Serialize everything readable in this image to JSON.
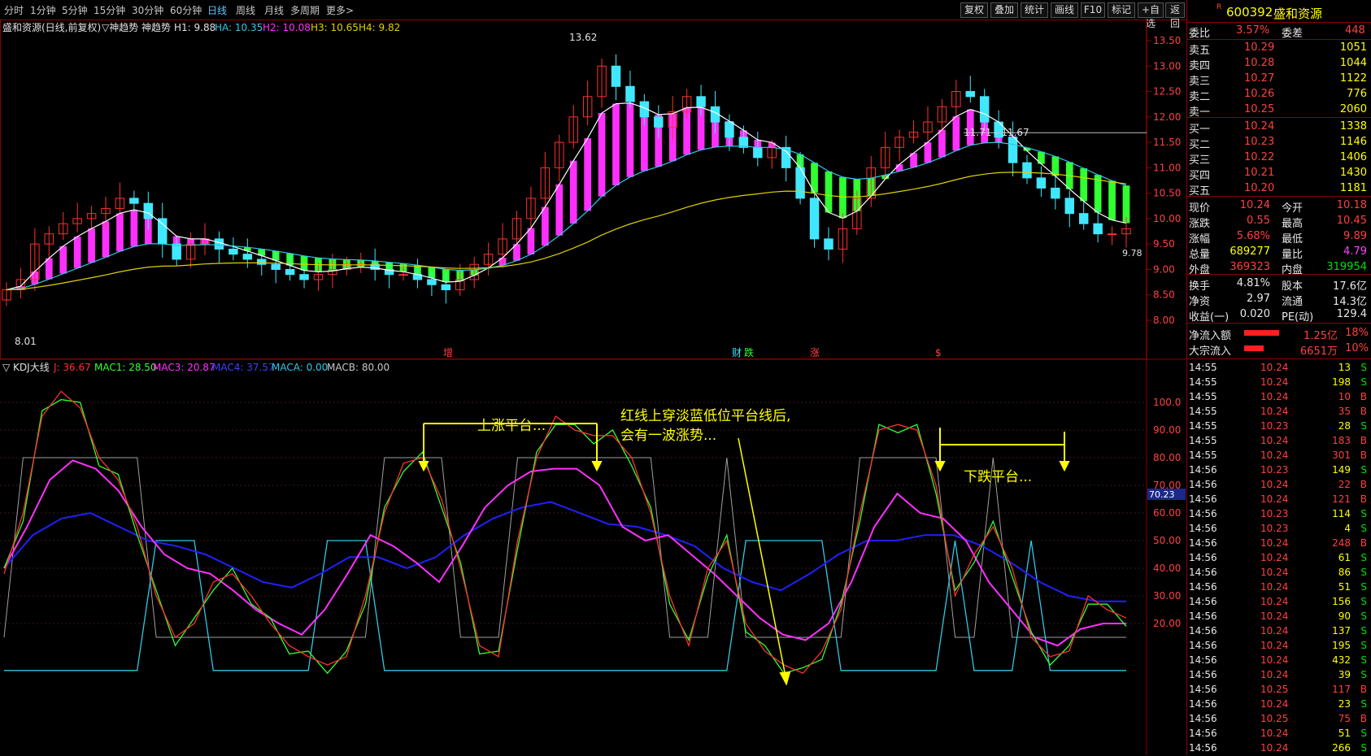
{
  "toolbar": {
    "periods": [
      "分时",
      "1分钟",
      "5分钟",
      "15分钟",
      "30分钟",
      "60分钟",
      "日线",
      "周线",
      "月线",
      "多周期",
      "更多>"
    ],
    "active_period": "日线",
    "buttons": [
      "复权",
      "叠加",
      "统计",
      "画线",
      "F10",
      "标记",
      "+自选",
      "返回"
    ]
  },
  "top_header": {
    "name": "盛和资源(日线,前复权)",
    "indicator": "▽神趋势 神趋势",
    "h1": "H1: 9.88",
    "ha": "HA: 10.35",
    "h2": "H2: 10.08",
    "h3": "H3: 10.65",
    "h4": "H4: 9.82"
  },
  "bottom_header": {
    "indicator": "▽ KDJ大线",
    "j": "J: 36.67",
    "mac1": "MAC1: 28.50",
    "mac3": "MAC3: 20.87",
    "mac4": "MAC4: 37.57",
    "maca": "MACA: 0.00",
    "macb": "MACB: 80.00"
  },
  "colors": {
    "up": "#ff3030",
    "down": "#40e8ff",
    "magenta": "#ff30ff",
    "green": "#30ff30",
    "yellow": "#e0d000",
    "frame": "#8b0000",
    "blue": "#2020ff",
    "cyan": "#30c8e8"
  },
  "annotations": {
    "up_platform": "上涨平台...",
    "cross_line1": "红线上穿淡蓝低位平台线后,",
    "cross_line2": "会有一波涨势...",
    "down_platform": "下跌平台..."
  },
  "chart_data": [
    {
      "type": "candlestick",
      "title": "盛和资源(日线,前复权)",
      "ylim": [
        7.8,
        13.8
      ],
      "y_ticks": [
        "13.50",
        "13.00",
        "12.50",
        "12.00",
        "11.50",
        "11.00",
        "10.50",
        "10.00",
        "9.50",
        "9.00",
        "8.50",
        "8.00"
      ],
      "price_labels": {
        "high": "13.62",
        "low": "8.01",
        "last": "9.78",
        "line": "11.71 - 11.67"
      },
      "events": [
        "增",
        "财",
        "跌",
        "涨",
        "$"
      ],
      "closes_approx": [
        8.6,
        8.8,
        9.5,
        9.7,
        9.9,
        10.0,
        10.1,
        10.2,
        10.4,
        10.3,
        10.0,
        9.5,
        9.2,
        9.5,
        9.6,
        9.4,
        9.3,
        9.2,
        9.1,
        9.0,
        8.9,
        8.8,
        8.9,
        9.0,
        9.1,
        9.1,
        9.0,
        8.9,
        8.9,
        8.8,
        8.7,
        8.6,
        8.8,
        9.1,
        9.3,
        9.6,
        10.0,
        10.4,
        11.0,
        11.5,
        12.0,
        12.4,
        13.0,
        12.6,
        12.3,
        12.0,
        11.8,
        12.1,
        12.4,
        12.2,
        11.9,
        11.6,
        11.4,
        11.2,
        11.4,
        11.0,
        10.4,
        9.6,
        9.4,
        9.8,
        10.4,
        11.0,
        11.4,
        11.6,
        11.7,
        11.9,
        12.2,
        12.5,
        12.4,
        11.9,
        11.6,
        11.1,
        10.8,
        10.6,
        10.4,
        10.1,
        9.9,
        9.7,
        9.7,
        9.8
      ],
      "lines": [
        {
          "name": "H1",
          "value": 9.88
        },
        {
          "name": "HA",
          "value": 10.35
        },
        {
          "name": "H2",
          "value": 10.08
        },
        {
          "name": "H3",
          "value": 10.65
        },
        {
          "name": "H4",
          "value": 9.82
        }
      ]
    },
    {
      "type": "line",
      "title": "KDJ大线",
      "ylim": [
        0,
        110
      ],
      "y_ticks": [
        "100.0",
        "90.00",
        "80.00",
        "70.00",
        "60.00",
        "50.00",
        "40.00",
        "30.00",
        "20.00"
      ],
      "cursor_label": "70.23",
      "series": [
        {
          "name": "J",
          "value": 36.67,
          "color": "#ff3030"
        },
        {
          "name": "MAC1",
          "value": 28.5,
          "color": "#30ff30"
        },
        {
          "name": "MAC3",
          "value": 20.87,
          "color": "#ff30ff"
        },
        {
          "name": "MAC4",
          "value": 37.57,
          "color": "#2020ff"
        },
        {
          "name": "MACA",
          "value": 0.0,
          "color": "#30c8e8"
        },
        {
          "name": "MACB",
          "value": 80.0,
          "color": "#c8c8c8"
        }
      ],
      "k_approx": [
        38,
        60,
        95,
        104,
        98,
        80,
        72,
        55,
        30,
        15,
        20,
        35,
        38,
        30,
        20,
        12,
        8,
        5,
        8,
        30,
        60,
        78,
        80,
        65,
        40,
        12,
        8,
        50,
        80,
        95,
        90,
        88,
        88,
        80,
        60,
        30,
        12,
        40,
        50,
        20,
        10,
        5,
        2,
        10,
        25,
        60,
        90,
        92,
        90,
        70,
        30,
        45,
        55,
        40,
        15,
        8,
        10,
        30,
        25,
        22
      ],
      "mac3_approx": [
        40,
        55,
        72,
        79,
        76,
        68,
        55,
        45,
        40,
        38,
        32,
        25,
        20,
        16,
        25,
        38,
        52,
        48,
        42,
        35,
        48,
        62,
        70,
        75,
        76,
        76,
        70,
        55,
        50,
        52,
        45,
        38,
        30,
        22,
        16,
        14,
        20,
        35,
        55,
        67,
        60,
        58,
        50,
        35,
        25,
        15,
        12,
        18,
        20,
        20
      ],
      "mac4_approx": [
        40,
        52,
        58,
        60,
        55,
        50,
        48,
        45,
        40,
        35,
        33,
        38,
        44,
        44,
        40,
        44,
        52,
        58,
        62,
        64,
        60,
        56,
        55,
        52,
        48,
        40,
        35,
        32,
        38,
        45,
        50,
        50,
        52,
        52,
        48,
        42,
        35,
        30,
        28,
        28
      ]
    }
  ],
  "quote": {
    "code": "600392",
    "name": "盛和资源",
    "tag": "R",
    "weibi_label": "委比",
    "weibi": "3.57%",
    "weicha_label": "委差",
    "weicha": "448",
    "asks": [
      {
        "label": "卖五",
        "price": "10.29",
        "vol": "1051"
      },
      {
        "label": "卖四",
        "price": "10.28",
        "vol": "1044"
      },
      {
        "label": "卖三",
        "price": "10.27",
        "vol": "1122"
      },
      {
        "label": "卖二",
        "price": "10.26",
        "vol": "776"
      },
      {
        "label": "卖一",
        "price": "10.25",
        "vol": "2060"
      }
    ],
    "bids": [
      {
        "label": "买一",
        "price": "10.24",
        "vol": "1338"
      },
      {
        "label": "买二",
        "price": "10.23",
        "vol": "1146"
      },
      {
        "label": "买三",
        "price": "10.22",
        "vol": "1406"
      },
      {
        "label": "买四",
        "price": "10.21",
        "vol": "1430"
      },
      {
        "label": "买五",
        "price": "10.20",
        "vol": "1181"
      }
    ],
    "stats": [
      {
        "l1": "现价",
        "v1": "10.24",
        "l2": "今开",
        "v2": "10.18"
      },
      {
        "l1": "涨跌",
        "v1": "0.55",
        "l2": "最高",
        "v2": "10.45"
      },
      {
        "l1": "涨幅",
        "v1": "5.68%",
        "l2": "最低",
        "v2": "9.89"
      },
      {
        "l1": "总量",
        "v1": "689277",
        "l2": "量比",
        "v2": "4.79"
      },
      {
        "l1": "外盘",
        "v1": "369323",
        "l2": "内盘",
        "v2": "319954"
      }
    ],
    "finance": [
      {
        "l1": "换手",
        "v1": "4.81%",
        "l2": "股本",
        "v2": "17.6亿"
      },
      {
        "l1": "净资",
        "v1": "2.97",
        "l2": "流通",
        "v2": "14.3亿"
      },
      {
        "l1": "收益(一)",
        "v1": "0.020",
        "l2": "PE(动)",
        "v2": "129.4"
      }
    ],
    "flows": [
      {
        "label": "净流入额",
        "value": "1.25亿",
        "pct": "18%",
        "bar_fraction": 0.18
      },
      {
        "label": "大宗流入",
        "value": "6651万",
        "pct": "10%",
        "bar_fraction": 0.1
      }
    ]
  },
  "ticks": [
    {
      "t": "14:55",
      "p": "10.24",
      "v": "13",
      "d": "S"
    },
    {
      "t": "14:55",
      "p": "10.24",
      "v": "198",
      "d": "S"
    },
    {
      "t": "14:55",
      "p": "10.24",
      "v": "10",
      "d": "B"
    },
    {
      "t": "14:55",
      "p": "10.24",
      "v": "35",
      "d": "B"
    },
    {
      "t": "14:55",
      "p": "10.23",
      "v": "28",
      "d": "S"
    },
    {
      "t": "14:55",
      "p": "10.24",
      "v": "183",
      "d": "B"
    },
    {
      "t": "14:55",
      "p": "10.24",
      "v": "301",
      "d": "B"
    },
    {
      "t": "14:56",
      "p": "10.23",
      "v": "149",
      "d": "S"
    },
    {
      "t": "14:56",
      "p": "10.24",
      "v": "22",
      "d": "B"
    },
    {
      "t": "14:56",
      "p": "10.24",
      "v": "121",
      "d": "B"
    },
    {
      "t": "14:56",
      "p": "10.23",
      "v": "114",
      "d": "S"
    },
    {
      "t": "14:56",
      "p": "10.23",
      "v": "4",
      "d": "S"
    },
    {
      "t": "14:56",
      "p": "10.24",
      "v": "248",
      "d": "B"
    },
    {
      "t": "14:56",
      "p": "10.24",
      "v": "61",
      "d": "S"
    },
    {
      "t": "14:56",
      "p": "10.24",
      "v": "86",
      "d": "S"
    },
    {
      "t": "14:56",
      "p": "10.24",
      "v": "51",
      "d": "S"
    },
    {
      "t": "14:56",
      "p": "10.24",
      "v": "156",
      "d": "S"
    },
    {
      "t": "14:56",
      "p": "10.24",
      "v": "90",
      "d": "S"
    },
    {
      "t": "14:56",
      "p": "10.24",
      "v": "137",
      "d": "S"
    },
    {
      "t": "14:56",
      "p": "10.24",
      "v": "195",
      "d": "S"
    },
    {
      "t": "14:56",
      "p": "10.24",
      "v": "432",
      "d": "S"
    },
    {
      "t": "14:56",
      "p": "10.24",
      "v": "39",
      "d": "S"
    },
    {
      "t": "14:56",
      "p": "10.25",
      "v": "117",
      "d": "B"
    },
    {
      "t": "14:56",
      "p": "10.24",
      "v": "23",
      "d": "S"
    },
    {
      "t": "14:56",
      "p": "10.25",
      "v": "75",
      "d": "B"
    },
    {
      "t": "14:56",
      "p": "10.24",
      "v": "51",
      "d": "S"
    },
    {
      "t": "14:56",
      "p": "10.24",
      "v": "266",
      "d": "S"
    }
  ]
}
